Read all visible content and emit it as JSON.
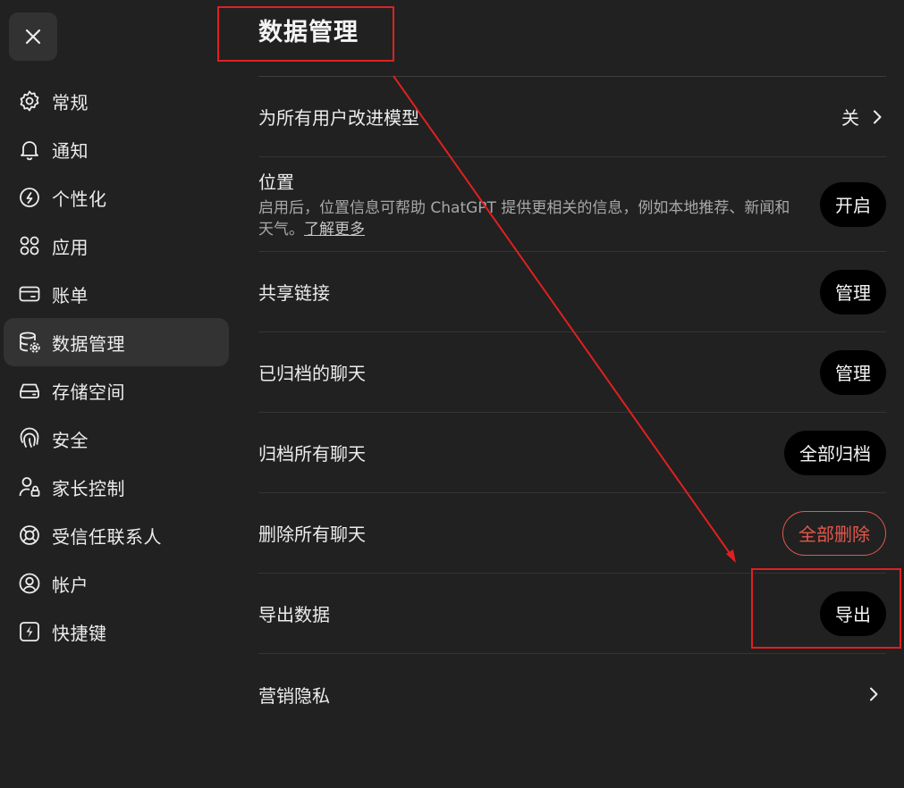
{
  "close": {
    "icon": "close-icon"
  },
  "sidebar": {
    "items": [
      {
        "label": "常规",
        "icon": "gear-icon",
        "active": false
      },
      {
        "label": "通知",
        "icon": "bell-icon",
        "active": false
      },
      {
        "label": "个性化",
        "icon": "personalization-icon",
        "active": false
      },
      {
        "label": "应用",
        "icon": "apps-grid-icon",
        "active": false
      },
      {
        "label": "账单",
        "icon": "credit-card-icon",
        "active": false
      },
      {
        "label": "数据管理",
        "icon": "database-gear-icon",
        "active": true
      },
      {
        "label": "存储空间",
        "icon": "storage-drive-icon",
        "active": false
      },
      {
        "label": "安全",
        "icon": "fingerprint-icon",
        "active": false
      },
      {
        "label": "家长控制",
        "icon": "parent-lock-icon",
        "active": false
      },
      {
        "label": "受信任联系人",
        "icon": "lifebuoy-icon",
        "active": false
      },
      {
        "label": "帐户",
        "icon": "user-circle-icon",
        "active": false
      },
      {
        "label": "快捷键",
        "icon": "lightning-key-icon",
        "active": false
      }
    ]
  },
  "header": {
    "title": "数据管理"
  },
  "settings": {
    "improve_model": {
      "label": "为所有用户改进模型",
      "value": "关"
    },
    "location": {
      "label": "位置",
      "description": "启用后，位置信息可帮助 ChatGPT 提供更相关的信息，例如本地推荐、新闻和天气。",
      "link": "了解更多",
      "button": "开启"
    },
    "shared_links": {
      "label": "共享链接",
      "button": "管理"
    },
    "archived_chats": {
      "label": "已归档的聊天",
      "button": "管理"
    },
    "archive_all": {
      "label": "归档所有聊天",
      "button": "全部归档"
    },
    "delete_all": {
      "label": "删除所有聊天",
      "button": "全部删除"
    },
    "export_data": {
      "label": "导出数据",
      "button": "导出"
    },
    "marketing_privacy": {
      "label": "营销隐私"
    }
  },
  "colors": {
    "background": "#212121",
    "active_item": "#333333",
    "pill": "#000000",
    "danger": "#e2574c",
    "annotation": "#e02020"
  }
}
